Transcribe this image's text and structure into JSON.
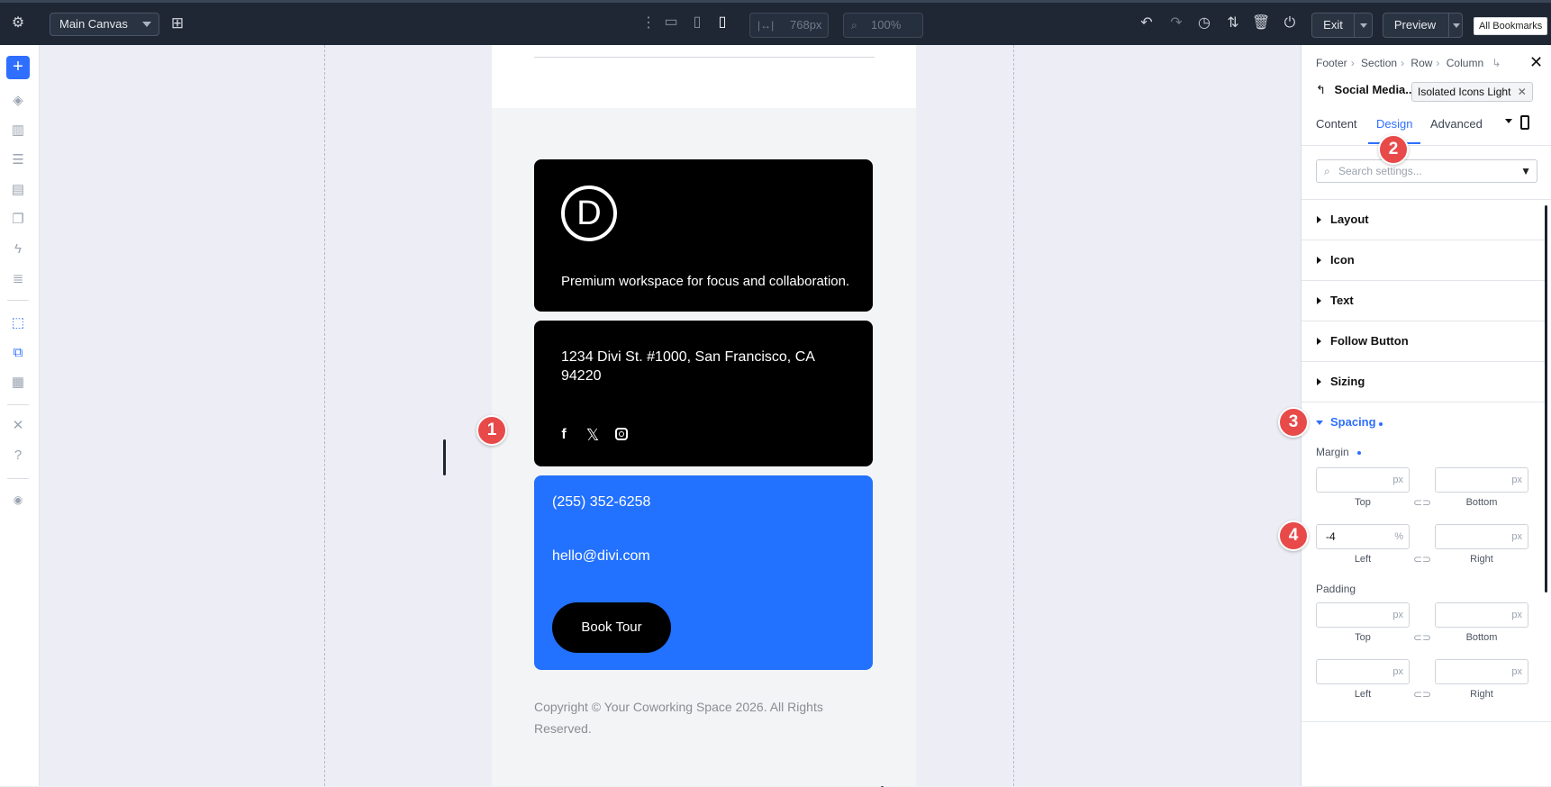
{
  "toolbar": {
    "canvas_select": "Main Canvas",
    "width_value": "768px",
    "zoom_value": "100%",
    "exit_label": "Exit",
    "preview_label": "Preview",
    "bookmarks_label": "All Bookmarks"
  },
  "page": {
    "tagline": "Premium workspace for focus and collaboration.",
    "logo_letter": "D",
    "address": "1234 Divi St. #1000, San Francisco, CA 94220",
    "phone": "(255) 352-6258",
    "email": "hello@divi.com",
    "book_button": "Book Tour",
    "copyright": "Copyright © Your Coworking Space 2026. All Rights Reserved.",
    "social_icons": [
      "facebook-icon",
      "x-icon",
      "instagram-icon"
    ]
  },
  "panel": {
    "breadcrumbs": [
      "Footer",
      "Section",
      "Row",
      "Column"
    ],
    "module_name": "Social Media...",
    "preset": "Isolated Icons Light",
    "tabs": [
      "Content",
      "Design",
      "Advanced"
    ],
    "active_tab": "Design",
    "search_placeholder": "Search settings...",
    "groups": [
      "Layout",
      "Icon",
      "Text",
      "Follow Button",
      "Sizing"
    ],
    "spacing_label": "Spacing",
    "margin_label": "Margin",
    "padding_label": "Padding",
    "margin": {
      "top": {
        "value": "",
        "unit": "px",
        "caption": "Top"
      },
      "bottom": {
        "value": "",
        "unit": "px",
        "caption": "Bottom"
      },
      "left": {
        "value": "-4",
        "unit": "%",
        "caption": "Left"
      },
      "right": {
        "value": "",
        "unit": "px",
        "caption": "Right"
      }
    },
    "padding": {
      "top": {
        "value": "",
        "unit": "px",
        "caption": "Top"
      },
      "bottom": {
        "value": "",
        "unit": "px",
        "caption": "Bottom"
      },
      "left": {
        "value": "",
        "unit": "px",
        "caption": "Left"
      },
      "right": {
        "value": "",
        "unit": "px",
        "caption": "Right"
      }
    }
  },
  "markers": [
    "1",
    "2",
    "3",
    "4"
  ],
  "colors": {
    "accent": "#2e6fff",
    "marker": "#e84a4a",
    "blue_card": "#2271ff",
    "toolbar_bg": "#1f2734"
  }
}
